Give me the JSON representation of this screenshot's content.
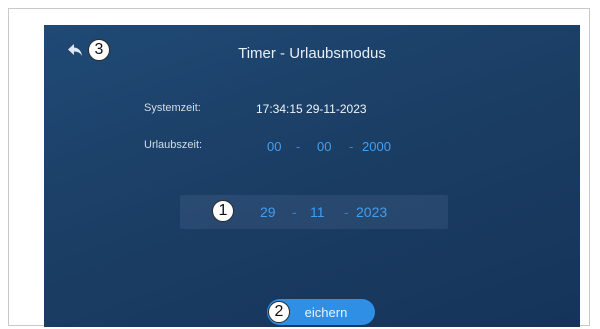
{
  "header": {
    "title": "Timer - Urlaubsmodus",
    "back_icon": "back-arrow-icon"
  },
  "system_time": {
    "label": "Systemzeit:",
    "value": "17:34:15  29-11-2023"
  },
  "vacation_time": {
    "label": "Urlaubszeit:",
    "day": "00",
    "month": "00",
    "year": "2000",
    "separator": "-"
  },
  "date_picker": {
    "day": "29",
    "month": "11",
    "year": "2023",
    "separator": "-"
  },
  "save_button": {
    "label": "eichern"
  },
  "callouts": {
    "one": "1",
    "two": "2",
    "three": "3"
  },
  "colors": {
    "screen_background": "#1b3e65",
    "accent_blue": "#3fa0f5",
    "button_blue": "#2f8fe5"
  }
}
